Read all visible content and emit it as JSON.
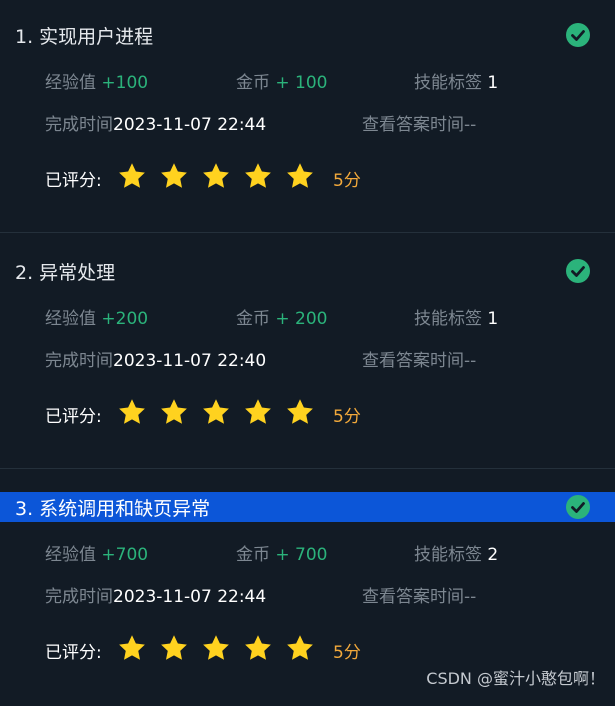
{
  "tasks": [
    {
      "title": "1. 实现用户进程",
      "exp_label": "经验值",
      "exp_value": "+100",
      "coin_label": "金币",
      "coin_value": "+ 100",
      "skill_label": "技能标签",
      "skill_value": "1",
      "finish_label": "完成时间",
      "finish_value": "2023-11-07 22:44",
      "answer_label": "查看答案时间",
      "answer_value": "--",
      "rating_label": "已评分:",
      "stars": 5,
      "score": "5分",
      "selected": false
    },
    {
      "title": "2. 异常处理",
      "exp_label": "经验值",
      "exp_value": "+200",
      "coin_label": "金币",
      "coin_value": "+ 200",
      "skill_label": "技能标签",
      "skill_value": "1",
      "finish_label": "完成时间",
      "finish_value": "2023-11-07 22:40",
      "answer_label": "查看答案时间",
      "answer_value": "--",
      "rating_label": "已评分:",
      "stars": 5,
      "score": "5分",
      "selected": false
    },
    {
      "title": "3. 系统调用和缺页异常",
      "exp_label": "经验值",
      "exp_value": "+700",
      "coin_label": "金币",
      "coin_value": "+ 700",
      "skill_label": "技能标签",
      "skill_value": "2",
      "finish_label": "完成时间",
      "finish_value": "2023-11-07 22:44",
      "answer_label": "查看答案时间",
      "answer_value": "--",
      "rating_label": "已评分:",
      "stars": 5,
      "score": "5分",
      "selected": true
    }
  ],
  "watermark": "CSDN @蜜汁小憨包啊！",
  "colors": {
    "green": "#2bb37b",
    "star": "#ffd21f",
    "score": "#f2a93b",
    "selected": "#0c56d8"
  }
}
